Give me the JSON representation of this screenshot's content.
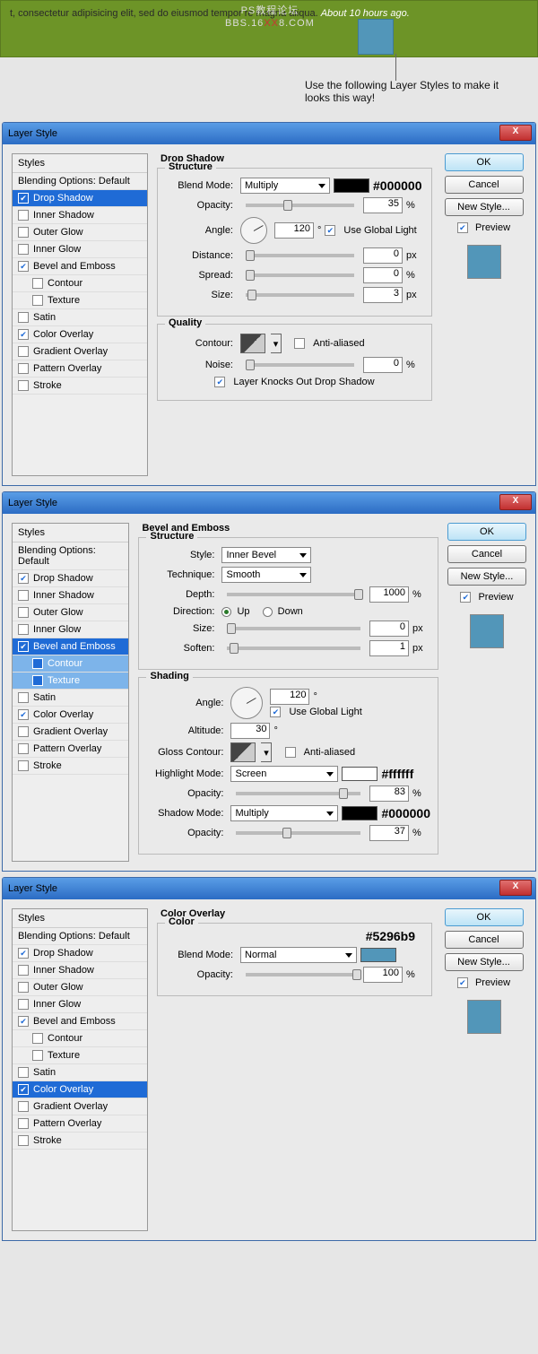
{
  "watermark": {
    "line1": "PS教程论坛",
    "line2_a": "BBS.16",
    "line2_b": "XX",
    "line2_c": "8.COM"
  },
  "header": {
    "text": "t, consectetur adipisicing elit, sed do eiusmod tempor re magna aliqua.",
    "timestamp": "About 10 hours ago."
  },
  "hint": "Use the following Layer Styles to make it looks this way!",
  "dialog_title": "Layer Style",
  "buttons": {
    "ok": "OK",
    "cancel": "Cancel",
    "newstyle": "New Style...",
    "preview": "Preview",
    "close": "X"
  },
  "styles_header": "Styles",
  "blending_default": "Blending Options: Default",
  "effects": {
    "drop_shadow": "Drop Shadow",
    "inner_shadow": "Inner Shadow",
    "outer_glow": "Outer Glow",
    "inner_glow": "Inner Glow",
    "bevel_emboss": "Bevel and Emboss",
    "contour": "Contour",
    "texture": "Texture",
    "satin": "Satin",
    "color_overlay": "Color Overlay",
    "gradient_overlay": "Gradient Overlay",
    "pattern_overlay": "Pattern Overlay",
    "stroke": "Stroke"
  },
  "labels": {
    "structure": "Structure",
    "quality": "Quality",
    "shading": "Shading",
    "color": "Color",
    "blend_mode": "Blend Mode:",
    "opacity": "Opacity:",
    "angle": "Angle:",
    "distance": "Distance:",
    "spread": "Spread:",
    "size": "Size:",
    "contour": "Contour:",
    "noise": "Noise:",
    "style": "Style:",
    "technique": "Technique:",
    "depth": "Depth:",
    "direction": "Direction:",
    "soften": "Soften:",
    "altitude": "Altitude:",
    "gloss_contour": "Gloss Contour:",
    "highlight_mode": "Highlight Mode:",
    "shadow_mode": "Shadow Mode:",
    "use_global": "Use Global Light",
    "anti_aliased": "Anti-aliased",
    "knockout": "Layer Knocks Out Drop Shadow",
    "up": "Up",
    "down": "Down",
    "px": "px",
    "pct": "%",
    "deg": "°"
  },
  "d1": {
    "title": "Drop Shadow",
    "blend_mode": "Multiply",
    "color": "#000000",
    "color_annot": "#000000",
    "opacity": "35",
    "angle": "120",
    "use_global": true,
    "distance": "0",
    "spread": "0",
    "size": "3",
    "anti_aliased": false,
    "noise": "0",
    "knockout": true
  },
  "d2": {
    "title": "Bevel and Emboss",
    "style": "Inner Bevel",
    "technique": "Smooth",
    "depth": "1000",
    "direction": "up",
    "size": "0",
    "soften": "1",
    "angle": "120",
    "use_global": true,
    "altitude": "30",
    "anti_aliased": false,
    "highlight_mode": "Screen",
    "highlight_color": "#ffffff",
    "highlight_annot": "#ffffff",
    "highlight_opacity": "83",
    "shadow_mode": "Multiply",
    "shadow_color": "#000000",
    "shadow_annot": "#000000",
    "shadow_opacity": "37"
  },
  "d3": {
    "title": "Color Overlay",
    "blend_mode": "Normal",
    "color": "#5296b9",
    "color_annot": "#5296b9",
    "opacity": "100"
  }
}
